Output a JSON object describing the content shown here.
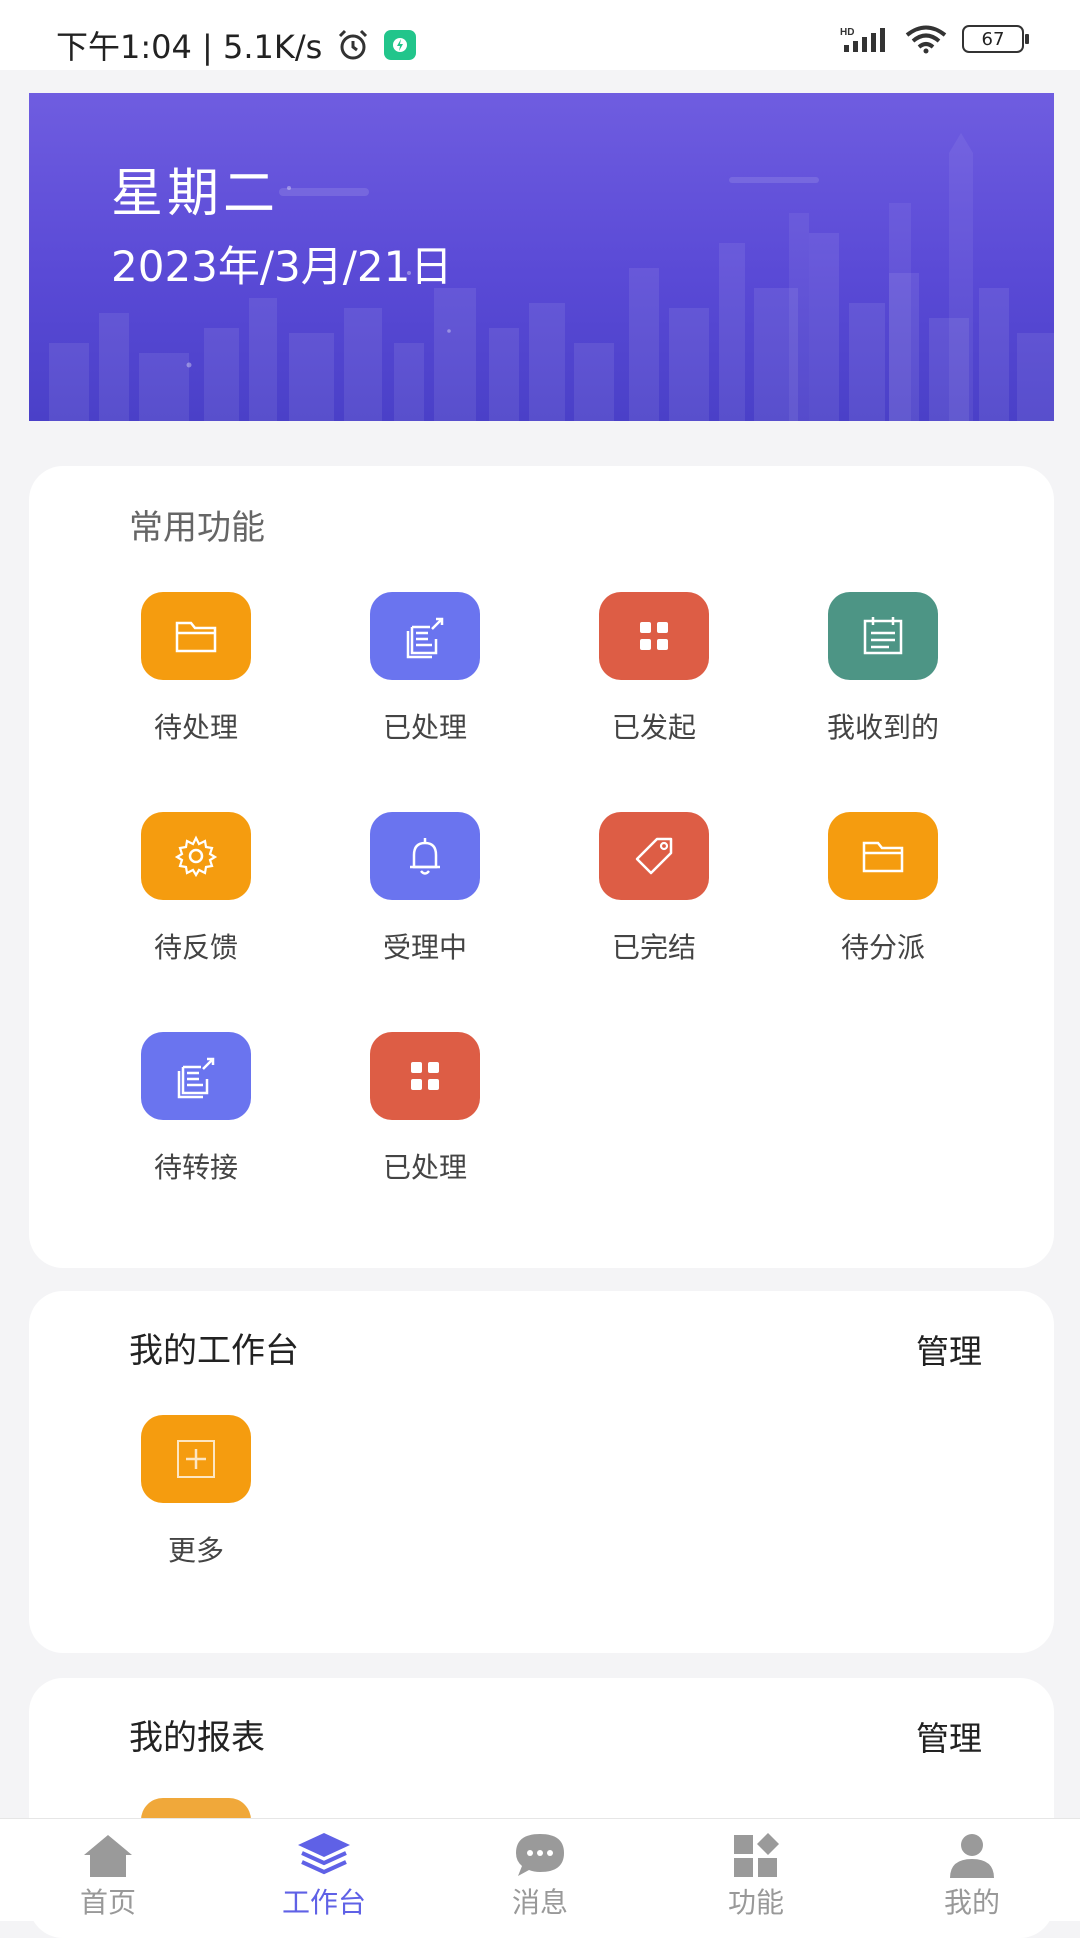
{
  "status_bar": {
    "time_speed": "下午1:04 | 5.1K/s",
    "battery": "67",
    "network_label": "HD"
  },
  "banner": {
    "weekday": "星期二",
    "date": "2023年/3月/21日"
  },
  "common_functions": {
    "title": "常用功能",
    "items": [
      {
        "label": "待处理",
        "icon": "folder-icon",
        "color": "#f59c0f"
      },
      {
        "label": "已处理",
        "icon": "export-icon",
        "color": "#6a74ef"
      },
      {
        "label": "已发起",
        "icon": "grid-icon",
        "color": "#dd5d45"
      },
      {
        "label": "我收到的",
        "icon": "calendar-list-icon",
        "color": "#4d9585"
      },
      {
        "label": "待反馈",
        "icon": "gear-icon",
        "color": "#f59c0f"
      },
      {
        "label": "受理中",
        "icon": "bell-icon",
        "color": "#6a74ef"
      },
      {
        "label": "已完结",
        "icon": "tag-icon",
        "color": "#dd5d45"
      },
      {
        "label": "待分派",
        "icon": "folder-icon",
        "color": "#f59c0f"
      },
      {
        "label": "待转接",
        "icon": "export-icon",
        "color": "#6a74ef"
      },
      {
        "label": "已处理",
        "icon": "grid-icon",
        "color": "#dd5d45"
      }
    ]
  },
  "my_workbench": {
    "title": "我的工作台",
    "manage_label": "管理",
    "items": [
      {
        "label": "更多",
        "icon": "plus-icon",
        "color": "#f59c0f"
      }
    ]
  },
  "my_reports": {
    "title": "我的报表",
    "manage_label": "管理"
  },
  "bottom_nav": {
    "items": [
      {
        "label": "首页",
        "icon": "home-icon"
      },
      {
        "label": "工作台",
        "icon": "layers-icon",
        "active": true
      },
      {
        "label": "消息",
        "icon": "chat-icon"
      },
      {
        "label": "功能",
        "icon": "apps-icon"
      },
      {
        "label": "我的",
        "icon": "user-icon"
      }
    ],
    "active_color": "#5f61e6",
    "inactive_color": "#999999"
  }
}
